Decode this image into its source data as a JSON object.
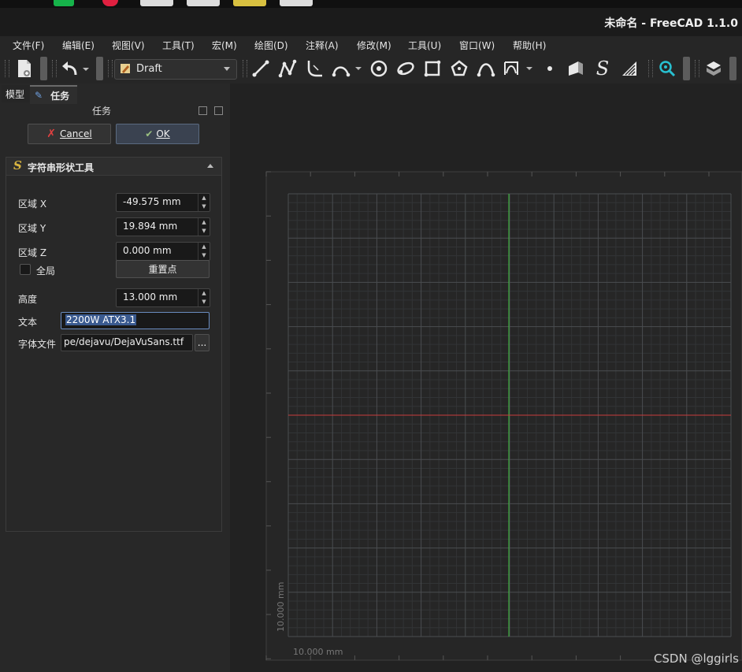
{
  "window": {
    "title": "未命名 - FreeCAD 1.1.0"
  },
  "menu": [
    "文件(F)",
    "编辑(E)",
    "视图(V)",
    "工具(T)",
    "宏(M)",
    "绘图(D)",
    "注释(A)",
    "修改(M)",
    "工具(U)",
    "窗口(W)",
    "帮助(H)"
  ],
  "toolbar": {
    "workbench": "Draft"
  },
  "panel": {
    "tab_model": "模型",
    "tab_tasks": "任务",
    "section_title": "任务",
    "cancel_label": "Cancel",
    "ok_label": "OK",
    "tool_title": "字符串形状工具",
    "x_label": "区域 X",
    "x_value": "-49.575 mm",
    "y_label": "区域 Y",
    "y_value": "19.894 mm",
    "z_label": "区域 Z",
    "z_value": "0.000 mm",
    "global_label": "全局",
    "reset_point_label": "重置点",
    "height_label": "高度",
    "height_value": "13.000 mm",
    "text_label": "文本",
    "text_value": "2200W ATX3.1",
    "font_label": "字体文件",
    "font_value": "pe/dejavu/DejaVuSans.ttf",
    "browse_label": "..."
  },
  "viewport": {
    "scale_x": "10.000 mm",
    "scale_y": "10.000 mm",
    "colors": {
      "x_axis": "#c83c3c",
      "y_axis": "#3fc43f",
      "grid": "#3a3d40"
    }
  },
  "watermark": "CSDN @lggirls"
}
